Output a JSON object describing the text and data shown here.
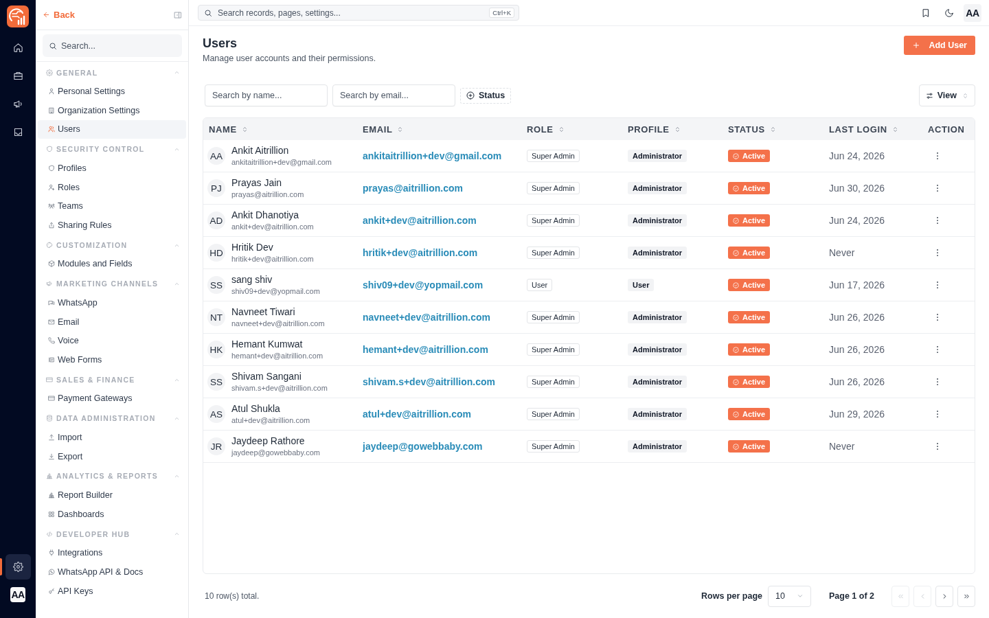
{
  "rail": {
    "top_items": [
      {
        "selected": false
      },
      {
        "selected": false
      },
      {
        "selected": false
      },
      {
        "selected": false
      }
    ],
    "bottom_items": [
      {
        "selected": true
      }
    ],
    "avatar": "AA"
  },
  "sidebar": {
    "back_label": "Back",
    "search": {
      "placeholder": "Search..."
    },
    "groups": [
      {
        "title": "GENERAL",
        "expanded": true,
        "items": [
          {
            "label": "Personal Settings",
            "selected": false
          },
          {
            "label": "Organization Settings",
            "selected": false
          },
          {
            "label": "Users",
            "selected": true
          }
        ]
      },
      {
        "title": "SECURITY CONTROL",
        "expanded": true,
        "items": [
          {
            "label": "Profiles",
            "selected": false
          },
          {
            "label": "Roles",
            "selected": false
          },
          {
            "label": "Teams",
            "selected": false
          },
          {
            "label": "Sharing Rules",
            "selected": false
          }
        ]
      },
      {
        "title": "CUSTOMIZATION",
        "expanded": true,
        "items": [
          {
            "label": "Modules and Fields",
            "selected": false
          }
        ]
      },
      {
        "title": "MARKETING CHANNELS",
        "expanded": true,
        "items": [
          {
            "label": "WhatsApp",
            "selected": false
          },
          {
            "label": "Email",
            "selected": false
          },
          {
            "label": "Voice",
            "selected": false
          },
          {
            "label": "Web Forms",
            "selected": false
          }
        ]
      },
      {
        "title": "SALES & FINANCE",
        "expanded": true,
        "items": [
          {
            "label": "Payment Gateways",
            "selected": false
          }
        ]
      },
      {
        "title": "DATA ADMINISTRATION",
        "expanded": true,
        "items": [
          {
            "label": "Import",
            "selected": false
          },
          {
            "label": "Export",
            "selected": false
          }
        ]
      },
      {
        "title": "ANALYTICS & REPORTS",
        "expanded": true,
        "items": [
          {
            "label": "Report Builder",
            "selected": false
          },
          {
            "label": "Dashboards",
            "selected": false
          }
        ]
      },
      {
        "title": "DEVELOPER HUB",
        "expanded": true,
        "items": [
          {
            "label": "Integrations",
            "selected": false
          },
          {
            "label": "WhatsApp API & Docs",
            "selected": false
          },
          {
            "label": "API Keys",
            "selected": false
          }
        ]
      }
    ]
  },
  "topbar": {
    "search": {
      "placeholder": "Search records, pages, settings...",
      "shortcut": "Ctrl+K"
    },
    "avatar": "AA"
  },
  "page": {
    "title": "Users",
    "subtitle": "Manage user accounts and their permissions.",
    "add_button": "Add User"
  },
  "filters": {
    "name_search": {
      "placeholder": "Search by name..."
    },
    "email_search": {
      "placeholder": "Search by email..."
    },
    "status_button": "Status",
    "view_button": "View"
  },
  "table": {
    "columns": [
      {
        "label": "NAME",
        "sortable": true
      },
      {
        "label": "EMAIL",
        "sortable": true
      },
      {
        "label": "ROLE",
        "sortable": true
      },
      {
        "label": "PROFILE",
        "sortable": true
      },
      {
        "label": "STATUS",
        "sortable": true
      },
      {
        "label": "LAST LOGIN",
        "sortable": true
      },
      {
        "label": "ACTION",
        "sortable": false
      }
    ],
    "rows": [
      {
        "initials": "AA",
        "name": "Ankit Aitrillion",
        "name_email": "ankitaitrillion+dev@gmail.com",
        "email": "ankitaitrillion+dev@gmail.com",
        "role": "Super Admin",
        "profile": "Administrator",
        "status": "Active",
        "last_login": "Jun 24, 2026"
      },
      {
        "initials": "PJ",
        "name": "Prayas Jain",
        "name_email": "prayas@aitrillion.com",
        "email": "prayas@aitrillion.com",
        "role": "Super Admin",
        "profile": "Administrator",
        "status": "Active",
        "last_login": "Jun 30, 2026"
      },
      {
        "initials": "AD",
        "name": "Ankit Dhanotiya",
        "name_email": "ankit+dev@aitrillion.com",
        "email": "ankit+dev@aitrillion.com",
        "role": "Super Admin",
        "profile": "Administrator",
        "status": "Active",
        "last_login": "Jun 24, 2026"
      },
      {
        "initials": "HD",
        "name": "Hritik Dev",
        "name_email": "hritik+dev@aitrillion.com",
        "email": "hritik+dev@aitrillion.com",
        "role": "Super Admin",
        "profile": "Administrator",
        "status": "Active",
        "last_login": "Never"
      },
      {
        "initials": "SS",
        "name": "sang shiv",
        "name_email": "shiv09+dev@yopmail.com",
        "email": "shiv09+dev@yopmail.com",
        "role": "User",
        "profile": "User",
        "status": "Active",
        "last_login": "Jun 17, 2026"
      },
      {
        "initials": "NT",
        "name": "Navneet Tiwari",
        "name_email": "navneet+dev@aitrillion.com",
        "email": "navneet+dev@aitrillion.com",
        "role": "Super Admin",
        "profile": "Administrator",
        "status": "Active",
        "last_login": "Jun 26, 2026"
      },
      {
        "initials": "HK",
        "name": "Hemant Kumwat",
        "name_email": "hemant+dev@aitrillion.com",
        "email": "hemant+dev@aitrillion.com",
        "role": "Super Admin",
        "profile": "Administrator",
        "status": "Active",
        "last_login": "Jun 26, 2026"
      },
      {
        "initials": "SS",
        "name": "Shivam Sangani",
        "name_email": "shivam.s+dev@aitrillion.com",
        "email": "shivam.s+dev@aitrillion.com",
        "role": "Super Admin",
        "profile": "Administrator",
        "status": "Active",
        "last_login": "Jun 26, 2026"
      },
      {
        "initials": "AS",
        "name": "Atul Shukla",
        "name_email": "atul+dev@aitrillion.com",
        "email": "atul+dev@aitrillion.com",
        "role": "Super Admin",
        "profile": "Administrator",
        "status": "Active",
        "last_login": "Jun 29, 2026"
      },
      {
        "initials": "JR",
        "name": "Jaydeep Rathore",
        "name_email": "jaydeep@gowebbaby.com",
        "email": "jaydeep@gowebbaby.com",
        "role": "Super Admin",
        "profile": "Administrator",
        "status": "Active",
        "last_login": "Never"
      }
    ]
  },
  "footer": {
    "total": "10 row(s) total.",
    "rows_per_page_label": "Rows per page",
    "rows_per_page": "10",
    "page_label": "Page 1 of 2",
    "pager_buttons": [
      {
        "disabled": true
      },
      {
        "disabled": true
      },
      {
        "disabled": false
      },
      {
        "disabled": false
      }
    ]
  }
}
